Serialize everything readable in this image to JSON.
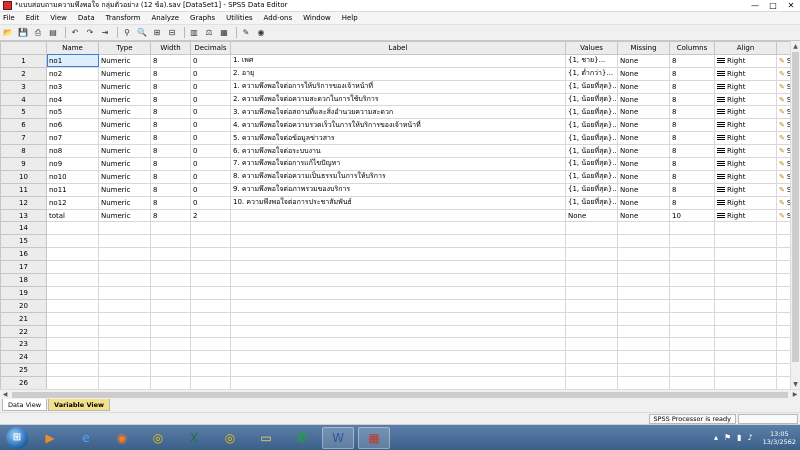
{
  "window": {
    "title": "*แบบสอบถามความพึงพอใจ กลุ่มตัวอย่าง (12 ข้อ).sav [DataSet1] - SPSS Data Editor",
    "minimize": "—",
    "maximize": "□",
    "close": "✕"
  },
  "menu": [
    "File",
    "Edit",
    "View",
    "Data",
    "Transform",
    "Analyze",
    "Graphs",
    "Utilities",
    "Add-ons",
    "Window",
    "Help"
  ],
  "toolbar": [
    "open-icon",
    "save-icon",
    "print-icon",
    "dialog-recall-icon",
    "undo-icon",
    "redo-icon",
    "goto-case-icon",
    "variables-icon",
    "find-icon",
    "insert-cases-icon",
    "insert-variable-icon",
    "split-file-icon",
    "weight-cases-icon",
    "select-cases-icon",
    "value-labels-icon",
    "use-sets-icon"
  ],
  "grid": {
    "columns": [
      "",
      "Name",
      "Type",
      "Width",
      "Decimals",
      "Label",
      "Values",
      "Missing",
      "Columns",
      "Align",
      "Me"
    ],
    "rows": [
      {
        "n": "1",
        "name": "no1",
        "type": "Numeric",
        "width": "8",
        "decimals": "0",
        "label": "1. เพศ",
        "values": "{1, ชาย}...",
        "missing": "None",
        "columns": "8",
        "align": "Right",
        "measure": "Sca"
      },
      {
        "n": "2",
        "name": "no2",
        "type": "Numeric",
        "width": "8",
        "decimals": "0",
        "label": "2. อายุ",
        "values": "{1, ต่ำกว่า}...",
        "missing": "None",
        "columns": "8",
        "align": "Right",
        "measure": "Sca"
      },
      {
        "n": "3",
        "name": "no3",
        "type": "Numeric",
        "width": "8",
        "decimals": "0",
        "label": "1. ความพึงพอใจต่อการให้บริการของเจ้าหน้าที่",
        "values": "{1, น้อยที่สุด}...",
        "missing": "None",
        "columns": "8",
        "align": "Right",
        "measure": "Sca"
      },
      {
        "n": "4",
        "name": "no4",
        "type": "Numeric",
        "width": "8",
        "decimals": "0",
        "label": "2. ความพึงพอใจต่อความสะดวกในการใช้บริการ",
        "values": "{1, น้อยที่สุด}...",
        "missing": "None",
        "columns": "8",
        "align": "Right",
        "measure": "Sca"
      },
      {
        "n": "5",
        "name": "no5",
        "type": "Numeric",
        "width": "8",
        "decimals": "0",
        "label": "3. ความพึงพอใจต่อสถานที่และสิ่งอำนวยความสะดวก",
        "values": "{1, น้อยที่สุด}...",
        "missing": "None",
        "columns": "8",
        "align": "Right",
        "measure": "Sca"
      },
      {
        "n": "6",
        "name": "no6",
        "type": "Numeric",
        "width": "8",
        "decimals": "0",
        "label": "4. ความพึงพอใจต่อความรวดเร็วในการให้บริการของเจ้าหน้าที่",
        "values": "{1, น้อยที่สุด}...",
        "missing": "None",
        "columns": "8",
        "align": "Right",
        "measure": "Sca"
      },
      {
        "n": "7",
        "name": "no7",
        "type": "Numeric",
        "width": "8",
        "decimals": "0",
        "label": "5. ความพึงพอใจต่อข้อมูลข่าวสาร",
        "values": "{1, น้อยที่สุด}...",
        "missing": "None",
        "columns": "8",
        "align": "Right",
        "measure": "Sca"
      },
      {
        "n": "8",
        "name": "no8",
        "type": "Numeric",
        "width": "8",
        "decimals": "0",
        "label": "6. ความพึงพอใจต่อระบบงาน",
        "values": "{1, น้อยที่สุด}...",
        "missing": "None",
        "columns": "8",
        "align": "Right",
        "measure": "Sca"
      },
      {
        "n": "9",
        "name": "no9",
        "type": "Numeric",
        "width": "8",
        "decimals": "0",
        "label": "7. ความพึงพอใจต่อการแก้ไขปัญหา",
        "values": "{1, น้อยที่สุด}...",
        "missing": "None",
        "columns": "8",
        "align": "Right",
        "measure": "Sca"
      },
      {
        "n": "10",
        "name": "no10",
        "type": "Numeric",
        "width": "8",
        "decimals": "0",
        "label": "8. ความพึงพอใจต่อความเป็นธรรมในการให้บริการ",
        "values": "{1, น้อยที่สุด}...",
        "missing": "None",
        "columns": "8",
        "align": "Right",
        "measure": "Sca"
      },
      {
        "n": "11",
        "name": "no11",
        "type": "Numeric",
        "width": "8",
        "decimals": "0",
        "label": "9. ความพึงพอใจต่อภาพรวมของบริการ",
        "values": "{1, น้อยที่สุด}...",
        "missing": "None",
        "columns": "8",
        "align": "Right",
        "measure": "Sca"
      },
      {
        "n": "12",
        "name": "no12",
        "type": "Numeric",
        "width": "8",
        "decimals": "0",
        "label": "10. ความพึงพอใจต่อการประชาสัมพันธ์",
        "values": "{1, น้อยที่สุด}...",
        "missing": "None",
        "columns": "8",
        "align": "Right",
        "measure": "Sca"
      },
      {
        "n": "13",
        "name": "total",
        "type": "Numeric",
        "width": "8",
        "decimals": "2",
        "label": "",
        "values": "None",
        "missing": "None",
        "columns": "10",
        "align": "Right",
        "measure": "Sca"
      }
    ],
    "empty_rows": [
      "14",
      "15",
      "16",
      "17",
      "18",
      "19",
      "20",
      "21",
      "22",
      "23",
      "24",
      "25",
      "26"
    ]
  },
  "tabs": {
    "data_view": "Data View",
    "variable_view": "Variable View"
  },
  "status": {
    "processor": "SPSS Processor is ready"
  },
  "taskbar": {
    "apps": [
      "media-player-icon",
      "ie-icon",
      "firefox-icon",
      "chrome-icon",
      "excel-icon",
      "chrome-alt-icon",
      "explorer-icon",
      "line-icon",
      "word-icon",
      "spss-icon"
    ],
    "time": "13:05",
    "date": "13/3/2562"
  }
}
